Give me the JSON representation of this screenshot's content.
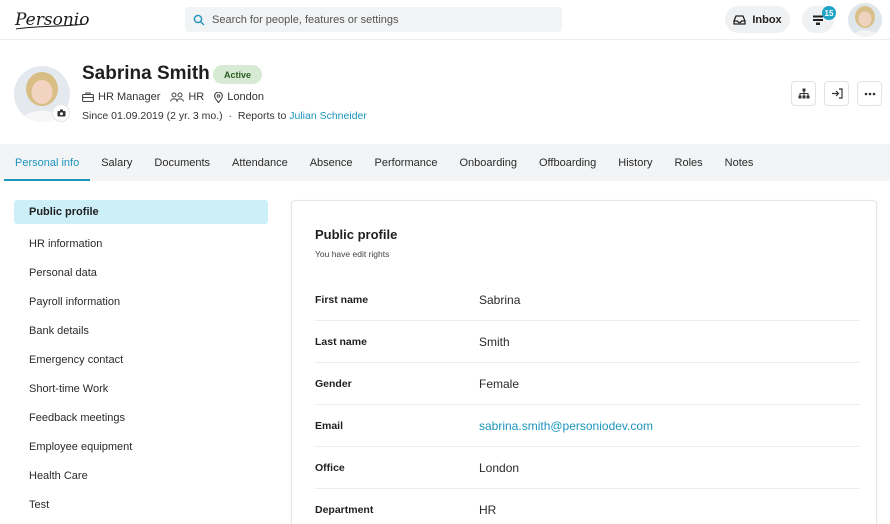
{
  "topbar": {
    "logo_text": "Personio",
    "search_placeholder": "Search for people, features or settings",
    "inbox_label": "Inbox",
    "tasks_count": "15"
  },
  "profile": {
    "name": "Sabrina Smith",
    "status": "Active",
    "position": "HR Manager",
    "department": "HR",
    "location": "London",
    "since_text": "Since 01.09.2019 (2 yr. 3 mo.)",
    "separator": "·",
    "reports_to_label": "Reports to",
    "reports_to_name": "Julian Schneider"
  },
  "tabs": [
    {
      "label": "Personal info",
      "active": true
    },
    {
      "label": "Salary"
    },
    {
      "label": "Documents"
    },
    {
      "label": "Attendance"
    },
    {
      "label": "Absence"
    },
    {
      "label": "Performance"
    },
    {
      "label": "Onboarding"
    },
    {
      "label": "Offboarding"
    },
    {
      "label": "History"
    },
    {
      "label": "Roles"
    },
    {
      "label": "Notes"
    }
  ],
  "sidenav": [
    {
      "label": "Public profile",
      "active": true
    },
    {
      "label": "HR information"
    },
    {
      "label": "Personal data"
    },
    {
      "label": "Payroll information"
    },
    {
      "label": "Bank details"
    },
    {
      "label": "Emergency contact"
    },
    {
      "label": "Short-time Work"
    },
    {
      "label": "Feedback meetings"
    },
    {
      "label": "Employee equipment"
    },
    {
      "label": "Health Care"
    },
    {
      "label": "Test"
    }
  ],
  "card": {
    "title": "Public profile",
    "subtitle": "You have edit rights",
    "rows": [
      {
        "label": "First name",
        "value": "Sabrina"
      },
      {
        "label": "Last name",
        "value": "Smith"
      },
      {
        "label": "Gender",
        "value": "Female"
      },
      {
        "label": "Email",
        "value": "sabrina.smith@personiodev.com",
        "link": true
      },
      {
        "label": "Office",
        "value": "London"
      },
      {
        "label": "Department",
        "value": "HR"
      }
    ]
  },
  "colors": {
    "accent": "#1d95bd",
    "badge": "#20a4c6",
    "status_bg": "#d7ead3",
    "nav_active_bg": "#cdeff7"
  }
}
